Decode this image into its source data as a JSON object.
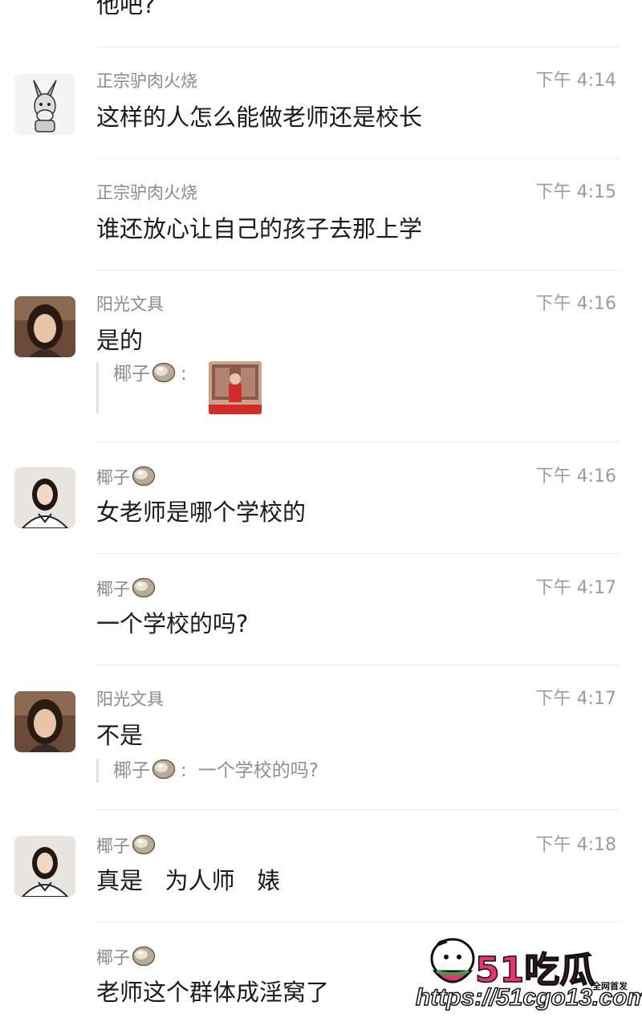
{
  "top_fragment": "他吧?",
  "messages": [
    {
      "sender": "正宗驴肉火烧",
      "time": "下午 4:14",
      "text": "这样的人怎么能做老师还是校长",
      "avatar": "donkey-avatar"
    },
    {
      "sender": "正宗驴肉火烧",
      "time": "下午 4:15",
      "text": "谁还放心让自己的孩子去那上学"
    },
    {
      "sender": "阳光文具",
      "time": "下午 4:16",
      "text": "是的",
      "avatar": "woman-avatar",
      "quote": {
        "sender": "椰子",
        "text": "",
        "has_image": true
      }
    },
    {
      "sender": "椰子",
      "time": "下午 4:16",
      "text": "女老师是哪个学校的",
      "avatar": "woman2-avatar"
    },
    {
      "sender": "椰子",
      "time": "下午 4:17",
      "text": "一个学校的吗?"
    },
    {
      "sender": "阳光文具",
      "time": "下午 4:17",
      "text": "不是",
      "avatar": "woman-avatar",
      "quote": {
        "sender": "椰子",
        "text": "一个学校的吗?"
      }
    },
    {
      "sender": "椰子",
      "time": "下午 4:18",
      "text": "真是   为人师   婊",
      "avatar": "woman2-avatar"
    },
    {
      "sender": "椰子",
      "time": "",
      "text": "老师这个群体成淫窝了"
    }
  ],
  "quote_separator": ":",
  "watermark": {
    "brand": "51吃瓜",
    "url": "https://51cgo13.com",
    "badge": "全网首发"
  },
  "colors": {
    "sender": "#8a8a8a",
    "time": "#9b9b9b",
    "text": "#1a1a1a",
    "divider": "#ececec",
    "brand": "#e8336f"
  }
}
